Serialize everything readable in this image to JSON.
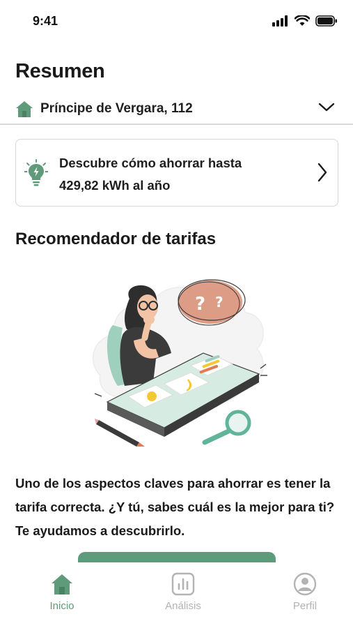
{
  "status_bar": {
    "time": "9:41"
  },
  "header": {
    "title": "Resumen"
  },
  "address": {
    "label": "Príncipe de Vergara, 112"
  },
  "tip_card": {
    "line1": "Descubre cómo ahorrar hasta",
    "line2": "429,82 kWh al año"
  },
  "section": {
    "title": "Recomendador de tarifas",
    "description": "Uno de los aspectos claves para ahorrar es tener la tarifa correcta. ¿Y tú, sabes cuál es la mejor para ti? Te ayudamos a descubrirlo."
  },
  "tab_bar": {
    "tabs": [
      {
        "label": "Inicio",
        "icon": "home-icon",
        "active": true
      },
      {
        "label": "Análisis",
        "icon": "chart-icon",
        "active": false
      },
      {
        "label": "Perfil",
        "icon": "profile-icon",
        "active": false
      }
    ]
  },
  "colors": {
    "accent": "#5f9b7a",
    "inactive": "#b3b3b3",
    "text": "#1a1a1a",
    "divider": "#d9d9d9"
  }
}
